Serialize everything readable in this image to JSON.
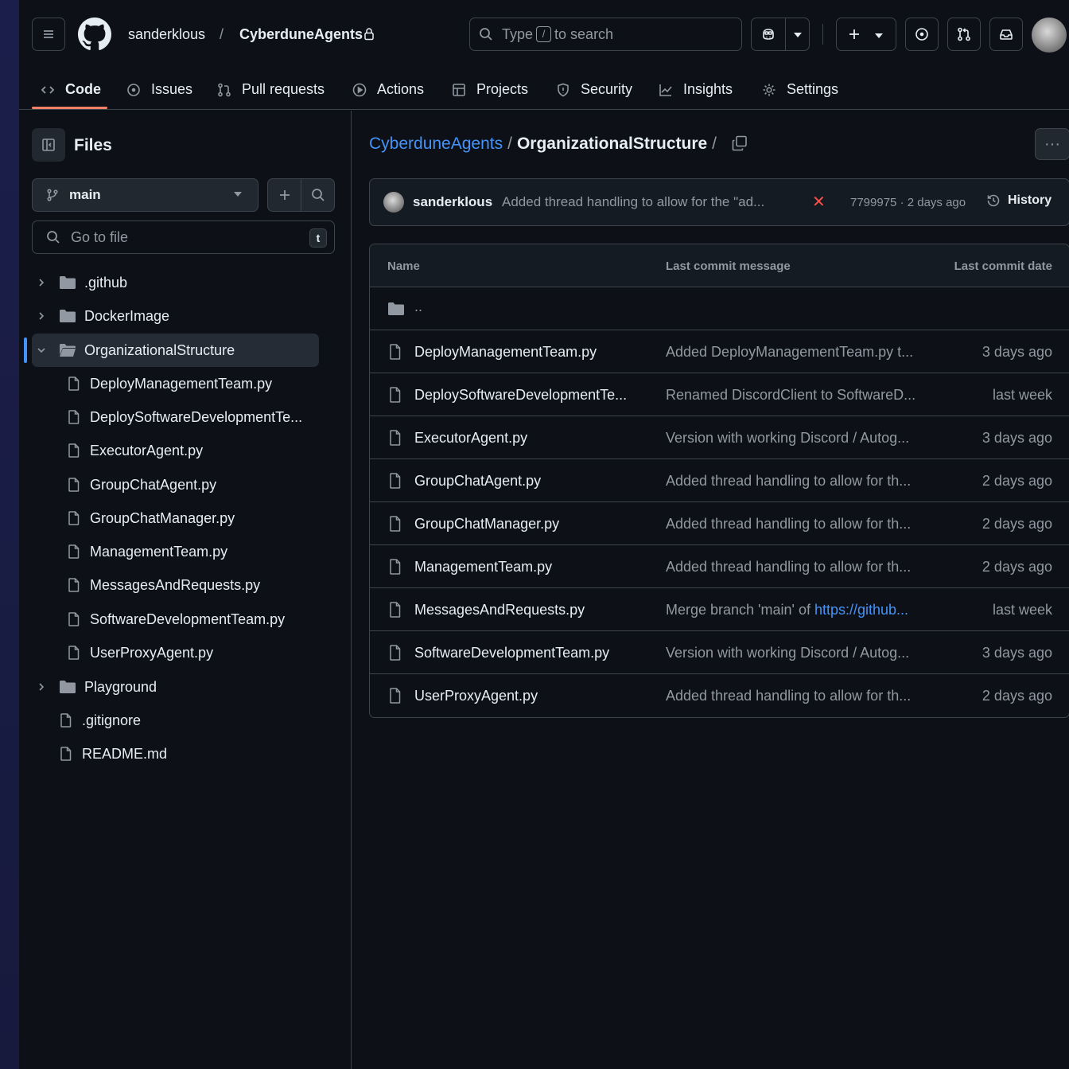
{
  "header": {
    "owner": "sanderklous",
    "separator": "/",
    "repo": "CyberduneAgents",
    "search_prefix": "Type",
    "search_key": "/",
    "search_suffix": "to search"
  },
  "repo_nav": {
    "tabs": [
      {
        "label": "Code",
        "icon": "code-icon",
        "active": true
      },
      {
        "label": "Issues",
        "icon": "issue-icon"
      },
      {
        "label": "Pull requests",
        "icon": "pull-request-icon"
      },
      {
        "label": "Actions",
        "icon": "play-icon"
      },
      {
        "label": "Projects",
        "icon": "table-icon"
      },
      {
        "label": "Security",
        "icon": "shield-icon"
      },
      {
        "label": "Insights",
        "icon": "graph-icon"
      },
      {
        "label": "Settings",
        "icon": "gear-icon"
      }
    ]
  },
  "sidebar": {
    "title": "Files",
    "branch": "main",
    "goto_placeholder": "Go to file",
    "goto_key": "t",
    "tree": [
      {
        "name": ".github",
        "type": "folder",
        "expanded": false
      },
      {
        "name": "DockerImage",
        "type": "folder",
        "expanded": false
      },
      {
        "name": "OrganizationalStructure",
        "type": "folder",
        "expanded": true,
        "selected": true
      },
      {
        "name": "DeployManagementTeam.py",
        "type": "file",
        "depth": 1
      },
      {
        "name": "DeploySoftwareDevelopmentTe...",
        "type": "file",
        "depth": 1
      },
      {
        "name": "ExecutorAgent.py",
        "type": "file",
        "depth": 1
      },
      {
        "name": "GroupChatAgent.py",
        "type": "file",
        "depth": 1
      },
      {
        "name": "GroupChatManager.py",
        "type": "file",
        "depth": 1
      },
      {
        "name": "ManagementTeam.py",
        "type": "file",
        "depth": 1
      },
      {
        "name": "MessagesAndRequests.py",
        "type": "file",
        "depth": 1
      },
      {
        "name": "SoftwareDevelopmentTeam.py",
        "type": "file",
        "depth": 1
      },
      {
        "name": "UserProxyAgent.py",
        "type": "file",
        "depth": 1
      },
      {
        "name": "Playground",
        "type": "folder",
        "expanded": false
      },
      {
        "name": ".gitignore",
        "type": "file",
        "depth": 0
      },
      {
        "name": "README.md",
        "type": "file",
        "depth": 0
      }
    ]
  },
  "main": {
    "breadcrumb_repo": "CyberduneAgents",
    "breadcrumb_sep": "/",
    "breadcrumb_current": "OrganizationalStructure",
    "breadcrumb_trailing": "/",
    "more_label": "···",
    "commit": {
      "author": "sanderklous",
      "message": "Added thread handling to allow for the \"ad...",
      "status": "✕",
      "meta": "7799975 · 2 days ago",
      "history_label": "History"
    },
    "table": {
      "headers": {
        "name": "Name",
        "message": "Last commit message",
        "date": "Last commit date"
      },
      "parent": "..",
      "rows": [
        {
          "name": "DeployManagementTeam.py",
          "message": "Added DeployManagementTeam.py t...",
          "date": "3 days ago"
        },
        {
          "name": "DeploySoftwareDevelopmentTe...",
          "message": "Renamed DiscordClient to SoftwareD...",
          "date": "last week"
        },
        {
          "name": "ExecutorAgent.py",
          "message": "Version with working Discord / Autog...",
          "date": "3 days ago"
        },
        {
          "name": "GroupChatAgent.py",
          "message": "Added thread handling to allow for th...",
          "date": "2 days ago"
        },
        {
          "name": "GroupChatManager.py",
          "message": "Added thread handling to allow for th...",
          "date": "2 days ago"
        },
        {
          "name": "ManagementTeam.py",
          "message": "Added thread handling to allow for th...",
          "date": "2 days ago"
        },
        {
          "name": "MessagesAndRequests.py",
          "message": "Merge branch 'main' of ",
          "message_link": "https://github...",
          "date": "last week"
        },
        {
          "name": "SoftwareDevelopmentTeam.py",
          "message": "Version with working Discord / Autog...",
          "date": "3 days ago"
        },
        {
          "name": "UserProxyAgent.py",
          "message": "Added thread handling to allow for th...",
          "date": "2 days ago"
        }
      ]
    }
  },
  "colors": {
    "accent_link": "#4493f8",
    "active_tab_underline": "#f78166",
    "status_fail": "#f85149",
    "page_bg": "#0d1117"
  }
}
